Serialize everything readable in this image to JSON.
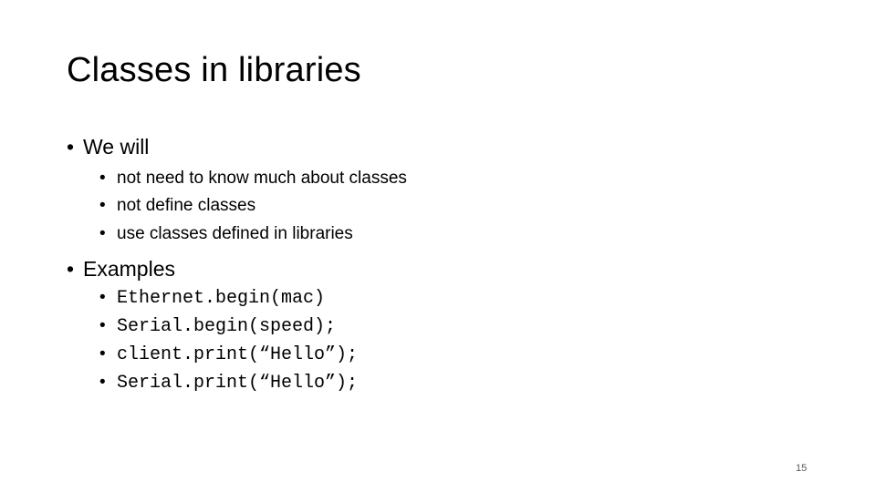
{
  "slide": {
    "title": "Classes in libraries",
    "sections": [
      {
        "bullet": "•",
        "heading": "We will",
        "items": [
          "not need to know much about classes",
          "not define classes",
          "use classes defined in libraries"
        ]
      },
      {
        "bullet": "•",
        "heading": "Examples",
        "items": [
          "Ethernet.begin(mac)",
          "Serial.begin(speed);",
          "client.print(“Hello”);",
          "Serial.print(“Hello”);"
        ]
      }
    ],
    "page_number": "15"
  }
}
